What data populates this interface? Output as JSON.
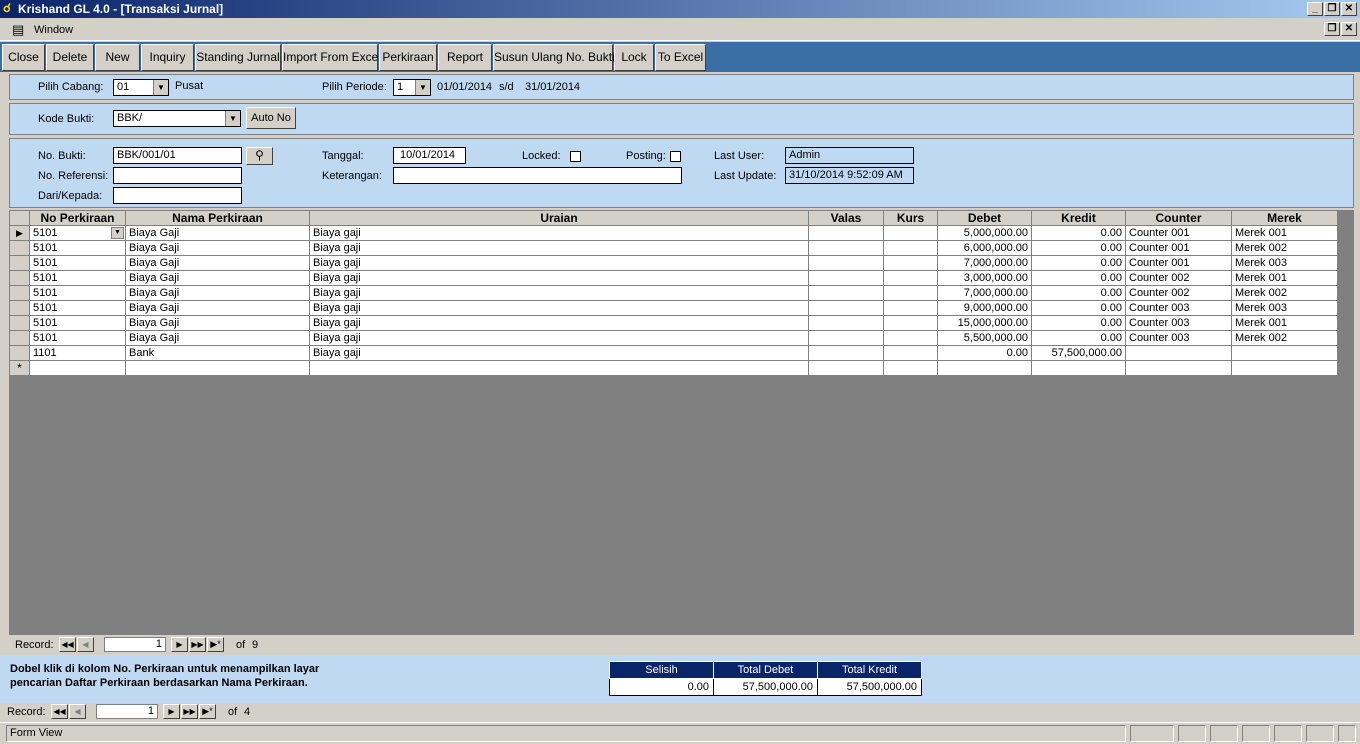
{
  "app": {
    "title": "Krishand GL 4.0 - [Transaksi Jurnal]"
  },
  "menu": {
    "window_label": "Window"
  },
  "toolbar": {
    "buttons": [
      "Close",
      "Delete",
      "New",
      "Inquiry",
      "Standing Jurnal",
      "Import From Excel",
      "Perkiraan",
      "Report",
      "Susun Ulang No. Bukti",
      "Lock",
      "To Excel"
    ]
  },
  "filter": {
    "cabang_label": "Pilih Cabang:",
    "cabang_value": "01",
    "cabang_name": "Pusat",
    "periode_label": "Pilih Periode:",
    "periode_value": "1",
    "periode_start": "01/01/2014",
    "periode_sep": "s/d",
    "periode_end": "31/01/2014"
  },
  "kode": {
    "label": "Kode Bukti:",
    "value": "BBK/",
    "auto_label": "Auto No"
  },
  "header": {
    "no_bukti_label": "No. Bukti:",
    "no_bukti_value": "BBK/001/01",
    "no_ref_label": "No. Referensi:",
    "no_ref_value": "",
    "dari_label": "Dari/Kepada:",
    "dari_value": "",
    "tanggal_label": "Tanggal:",
    "tanggal_value": "10/01/2014",
    "keterangan_label": "Keterangan:",
    "keterangan_value": "",
    "locked_label": "Locked:",
    "posting_label": "Posting:",
    "last_user_label": "Last User:",
    "last_user_value": "Admin",
    "last_update_label": "Last Update:",
    "last_update_value": "31/10/2014 9:52:09 AM"
  },
  "grid": {
    "columns": [
      "No Perkiraan",
      "Nama Perkiraan",
      "Uraian",
      "Valas",
      "Kurs",
      "Debet",
      "Kredit",
      "Counter",
      "Merek"
    ],
    "rows": [
      [
        "5101",
        "Biaya Gaji",
        "Biaya gaji",
        "",
        "",
        "5,000,000.00",
        "0.00",
        "Counter 001",
        "Merek 001"
      ],
      [
        "5101",
        "Biaya Gaji",
        "Biaya gaji",
        "",
        "",
        "6,000,000.00",
        "0.00",
        "Counter 001",
        "Merek 002"
      ],
      [
        "5101",
        "Biaya Gaji",
        "Biaya gaji",
        "",
        "",
        "7,000,000.00",
        "0.00",
        "Counter 001",
        "Merek 003"
      ],
      [
        "5101",
        "Biaya Gaji",
        "Biaya gaji",
        "",
        "",
        "3,000,000.00",
        "0.00",
        "Counter 002",
        "Merek 001"
      ],
      [
        "5101",
        "Biaya Gaji",
        "Biaya gaji",
        "",
        "",
        "7,000,000.00",
        "0.00",
        "Counter 002",
        "Merek 002"
      ],
      [
        "5101",
        "Biaya Gaji",
        "Biaya gaji",
        "",
        "",
        "9,000,000.00",
        "0.00",
        "Counter 003",
        "Merek 003"
      ],
      [
        "5101",
        "Biaya Gaji",
        "Biaya gaji",
        "",
        "",
        "15,000,000.00",
        "0.00",
        "Counter 003",
        "Merek 001"
      ],
      [
        "5101",
        "Biaya Gaji",
        "Biaya gaji",
        "",
        "",
        "5,500,000.00",
        "0.00",
        "Counter 003",
        "Merek 002"
      ],
      [
        "1101",
        "Bank",
        "Biaya gaji",
        "",
        "",
        "0.00",
        "57,500,000.00",
        "",
        ""
      ]
    ],
    "nav": {
      "label": "Record:",
      "current": "1",
      "of_label": "of",
      "total": "9"
    }
  },
  "hint": "Dobel klik di kolom No. Perkiraan untuk menampilkan layar pencarian Daftar Perkiraan berdasarkan Nama Perkiraan.",
  "totals": {
    "selisih_label": "Selisih",
    "selisih_value": "0.00",
    "debet_label": "Total Debet",
    "debet_value": "57,500,000.00",
    "kredit_label": "Total Kredit",
    "kredit_value": "57,500,000.00"
  },
  "form_nav": {
    "label": "Record:",
    "current": "1",
    "of_label": "of",
    "total": "4"
  },
  "status": {
    "text": "Form View"
  }
}
